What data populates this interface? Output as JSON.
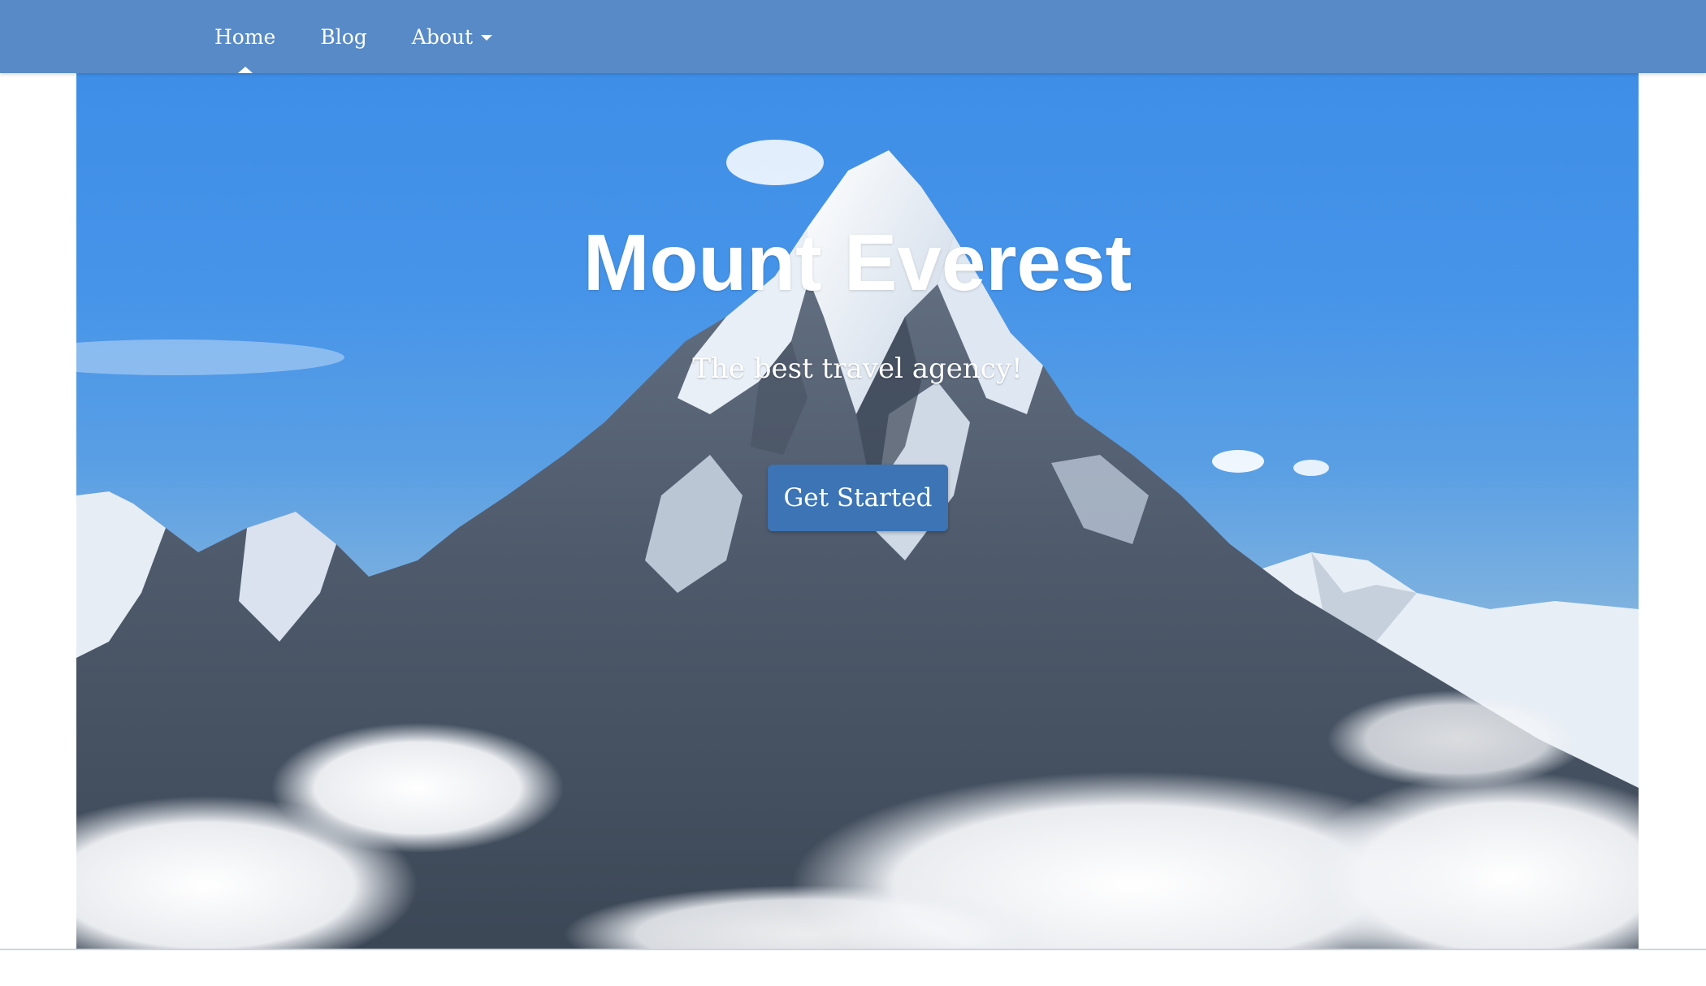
{
  "nav": {
    "items": [
      {
        "label": "Home",
        "active": true
      },
      {
        "label": "Blog",
        "active": false
      },
      {
        "label": "About",
        "active": false,
        "has_dropdown": true
      }
    ]
  },
  "hero": {
    "title": "Mount Everest",
    "subtitle": "The best travel agency!",
    "cta_label": "Get Started"
  },
  "colors": {
    "navbar": "#588ac7",
    "cta": "#3c74b5",
    "sky": "#3e8ee8"
  }
}
